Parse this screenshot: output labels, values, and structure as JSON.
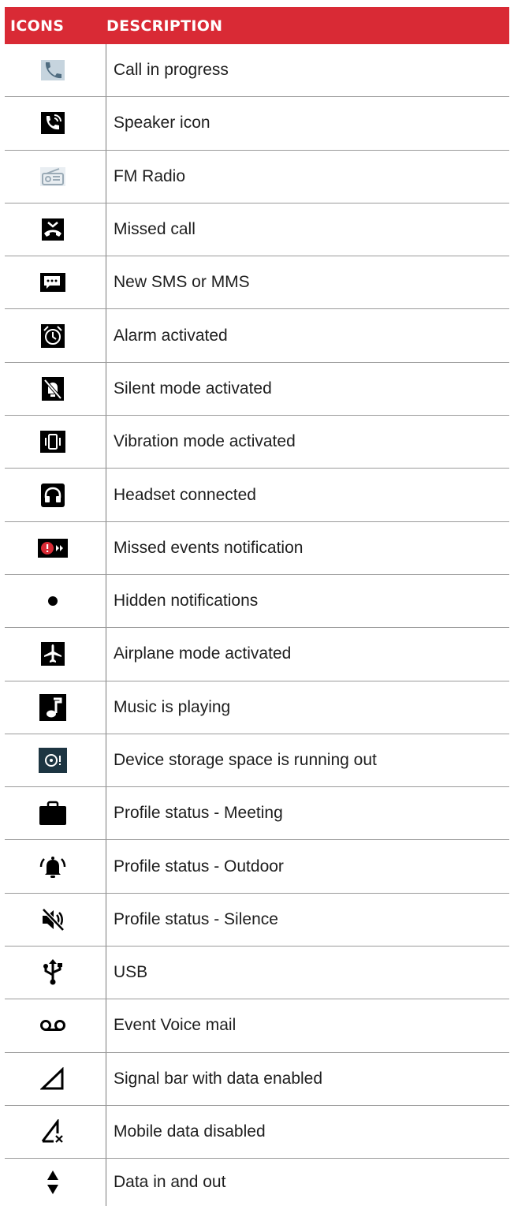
{
  "header": {
    "col_icons": "ICONS",
    "col_description": "DESCRIPTION"
  },
  "colors": {
    "header_bg": "#d92a35",
    "header_text": "#ffffff",
    "icon_dark": "#000000",
    "icon_grey": "#9a9a9a"
  },
  "rows": [
    {
      "icon": "call-in-progress-icon",
      "label": "Call in progress"
    },
    {
      "icon": "speaker-icon",
      "label": "Speaker icon"
    },
    {
      "icon": "fm-radio-icon",
      "label": "FM Radio"
    },
    {
      "icon": "missed-call-icon",
      "label": "Missed call"
    },
    {
      "icon": "new-sms-icon",
      "label": "New SMS or MMS"
    },
    {
      "icon": "alarm-icon",
      "label": "Alarm activated"
    },
    {
      "icon": "silent-mode-icon",
      "label": "Silent mode activated"
    },
    {
      "icon": "vibration-mode-icon",
      "label": "Vibration mode activated"
    },
    {
      "icon": "headset-icon",
      "label": "Headset connected"
    },
    {
      "icon": "missed-events-icon",
      "label": "Missed events notification"
    },
    {
      "icon": "hidden-notifications-icon",
      "label": "Hidden notifications"
    },
    {
      "icon": "airplane-mode-icon",
      "label": "Airplane mode activated"
    },
    {
      "icon": "music-playing-icon",
      "label": "Music is playing"
    },
    {
      "icon": "storage-low-icon",
      "label": "Device storage space is running out"
    },
    {
      "icon": "briefcase-icon",
      "label": "Profile status - Meeting"
    },
    {
      "icon": "bell-ringing-icon",
      "label": "Profile status - Outdoor"
    },
    {
      "icon": "speaker-muted-icon",
      "label": "Profile status - Silence"
    },
    {
      "icon": "usb-icon",
      "label": "USB"
    },
    {
      "icon": "voicemail-icon",
      "label": "Event Voice mail"
    },
    {
      "icon": "signal-bar-icon",
      "label": "Signal bar with data enabled"
    },
    {
      "icon": "mobile-data-disabled-icon",
      "label": "Mobile data disabled"
    },
    {
      "icon": "data-in-out-icon",
      "label": "Data in and out"
    }
  ]
}
